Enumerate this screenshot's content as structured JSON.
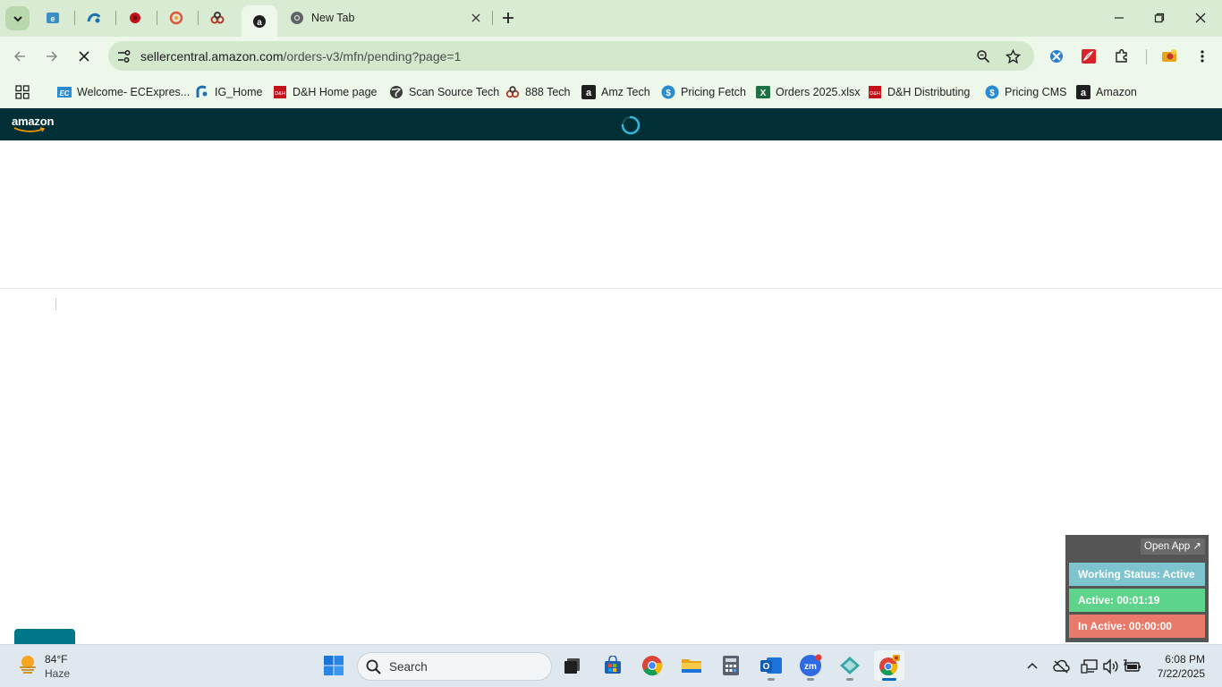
{
  "browser": {
    "pinned_tabs": [
      "ecexpress-tab",
      "ig-tab",
      "dh-tab",
      "888-tab",
      "amz-tech-tab"
    ],
    "active_tab": "amazon-tab",
    "new_tab": {
      "title": "New Tab"
    },
    "url": {
      "host": "sellercentral.amazon.com",
      "path": "/orders-v3/mfn/pending?page=1"
    },
    "bookmarks": [
      {
        "label": "Welcome- ECExpres...",
        "icon": "ec-icon"
      },
      {
        "label": "IG_Home",
        "icon": "ig-icon"
      },
      {
        "label": "D&H Home page",
        "icon": "dh-icon"
      },
      {
        "label": "Scan Source Tech",
        "icon": "globe-icon"
      },
      {
        "label": "888 Tech",
        "icon": "888-icon"
      },
      {
        "label": "Amz Tech",
        "icon": "amazon-icon"
      },
      {
        "label": "Pricing Fetch",
        "icon": "dollar-icon"
      },
      {
        "label": "Orders 2025.xlsx",
        "icon": "excel-icon"
      },
      {
        "label": "D&H Distributing",
        "icon": "dh-icon"
      },
      {
        "label": "Pricing CMS",
        "icon": "dollar-icon"
      },
      {
        "label": "Amazon",
        "icon": "amazon-icon"
      }
    ]
  },
  "page": {
    "logo": "amazon",
    "loading": true
  },
  "tracker": {
    "open_app": "Open App ↗",
    "status": "Working Status: Active",
    "active": "Active: 00:01:19",
    "inactive": "In Active: 00:00:00",
    "colors": {
      "status": "#7ec4cf",
      "active": "#5ed38a",
      "inactive": "#e8796b"
    }
  },
  "taskbar": {
    "weather": {
      "temp": "84°F",
      "condition": "Haze"
    },
    "search_placeholder": "Search",
    "clock": {
      "time": "6:08 PM",
      "date": "7/22/2025"
    }
  },
  "colors": {
    "amazon_header": "#002f36",
    "tab_strip": "#d9ecd3",
    "toolbar": "#eef8ea"
  }
}
